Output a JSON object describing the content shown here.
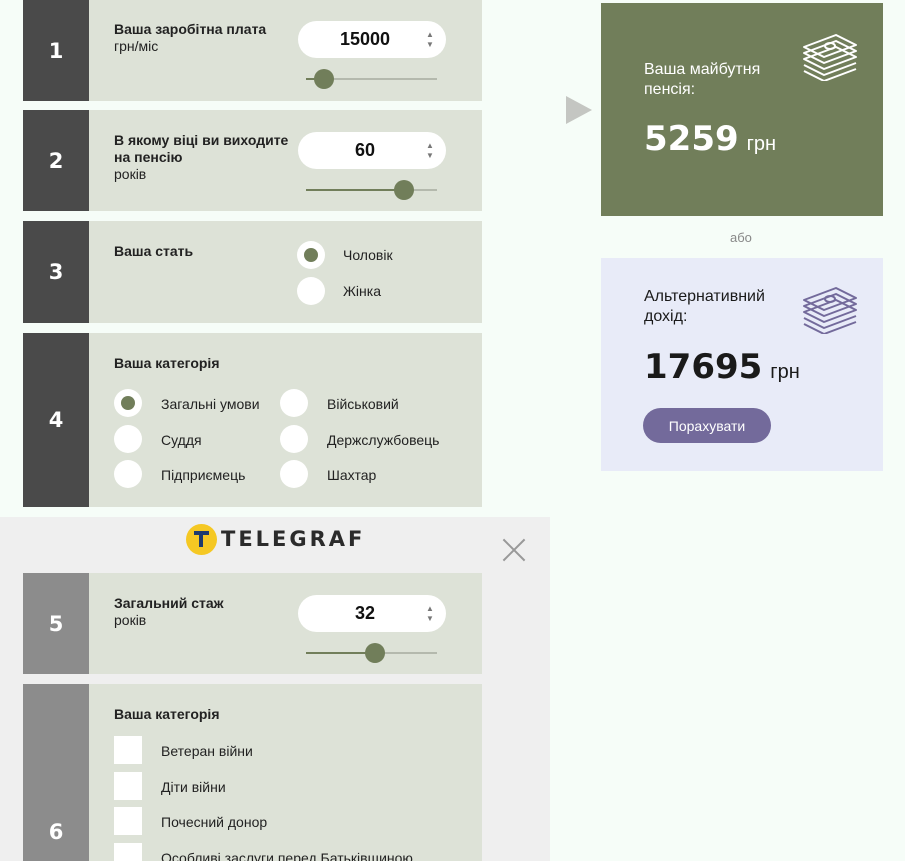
{
  "steps": {
    "s1": {
      "num": "1",
      "label_bold": "Ваша заробітна плата",
      "label_sub": "грн/міс",
      "value": "15000",
      "level": 0.14
    },
    "s2": {
      "num": "2",
      "label_bold": "В якому віці ви виходите на пенсію",
      "label_sub": "років",
      "value": "60",
      "level": 0.75
    },
    "s3": {
      "num": "3",
      "label_bold": "Ваша стать",
      "options": [
        "Чоловік",
        "Жінка"
      ],
      "selected": "Чоловік"
    },
    "s4": {
      "num": "4",
      "label_bold": "Ваша категорія",
      "options": [
        "Загальні умови",
        "Військовий",
        "Суддя",
        "Держслужбовець",
        "Підприємець",
        "Шахтар"
      ],
      "selected": "Загальні умови"
    },
    "s5": {
      "num": "5",
      "label_bold": "Загальний стаж",
      "label_sub": "років",
      "value": "32",
      "level": 0.53
    },
    "s6": {
      "num": "6",
      "label_bold": "Ваша категорія",
      "options": [
        "Ветеран війни",
        "Діти війни",
        "Почесний донор",
        "Особливі заслуги перед Батьківщиною"
      ]
    }
  },
  "ad": {
    "brand": "TELEGRAF"
  },
  "result": {
    "pension_title": "Ваша майбутня пенсія:",
    "pension_amount": "5259",
    "currency": "грн",
    "or": "або",
    "alt_title": "Альтернативний дохід:",
    "alt_amount": "17695",
    "button": "Порахувати"
  },
  "colors": {
    "accent": "#717e5a",
    "button": "#736a9b",
    "step_dark": "#4a4a4a",
    "panel": "#dde2d7",
    "alt_card": "#e8ebf8"
  },
  "icons": [
    "money-stack-icon",
    "close-icon",
    "arrow-right-icon",
    "spinner-arrows-icon"
  ]
}
